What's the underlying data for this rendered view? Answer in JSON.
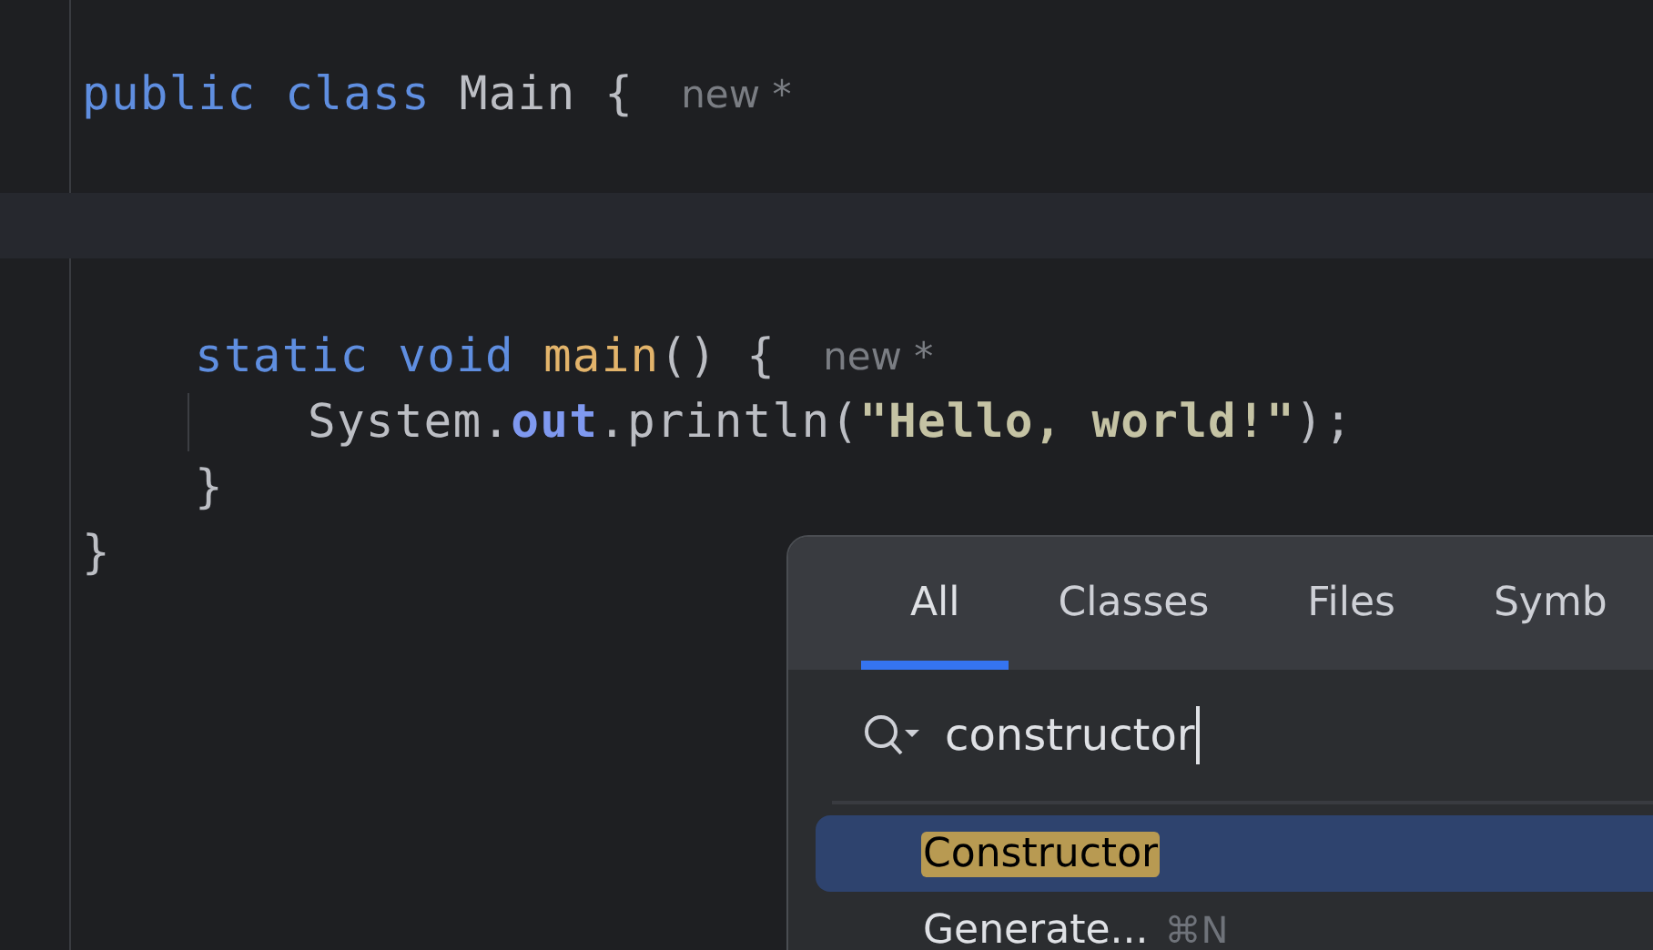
{
  "editor": {
    "lines": [
      {
        "kind": "code",
        "tokens": [
          {
            "kind": "keyword",
            "text": "public "
          },
          {
            "kind": "keyword",
            "text": "class "
          },
          {
            "kind": "plain",
            "text": "Main {"
          }
        ],
        "hint": "new *",
        "children": [
          {
            "kind": "blank"
          },
          {
            "kind": "current_line"
          },
          {
            "kind": "blank"
          },
          {
            "kind": "code",
            "tokens": [
              {
                "kind": "keyword",
                "text": "static "
              },
              {
                "kind": "keyword",
                "text": "void "
              },
              {
                "kind": "method",
                "text": "main"
              },
              {
                "kind": "plain",
                "text": "() {"
              }
            ],
            "hint": "new *",
            "children": [
              {
                "kind": "code",
                "tokens": [
                  {
                    "kind": "plain",
                    "text": "System."
                  },
                  {
                    "kind": "field",
                    "text": "out"
                  },
                  {
                    "kind": "plain",
                    "text": ".println("
                  },
                  {
                    "kind": "string",
                    "text": "\"Hello, world!\""
                  },
                  {
                    "kind": "plain",
                    "text": ");"
                  }
                ]
              }
            ]
          },
          {
            "kind": "code",
            "tokens": [
              {
                "kind": "plain",
                "text": "}"
              }
            ]
          }
        ]
      },
      {
        "kind": "code",
        "tokens": [
          {
            "kind": "plain",
            "text": "}"
          }
        ]
      }
    ]
  },
  "search_popup": {
    "tabs": [
      {
        "label": "All",
        "selected": true
      },
      {
        "label": "Classes",
        "selected": false
      },
      {
        "label": "Files",
        "selected": false
      },
      {
        "label": "Symb",
        "selected": false
      }
    ],
    "query": "constructor",
    "results": [
      {
        "label": "Constructor",
        "selected": true,
        "match": true
      },
      {
        "label": "Generate...",
        "shortcut": "⌘N",
        "selected": false,
        "match": false
      }
    ]
  }
}
